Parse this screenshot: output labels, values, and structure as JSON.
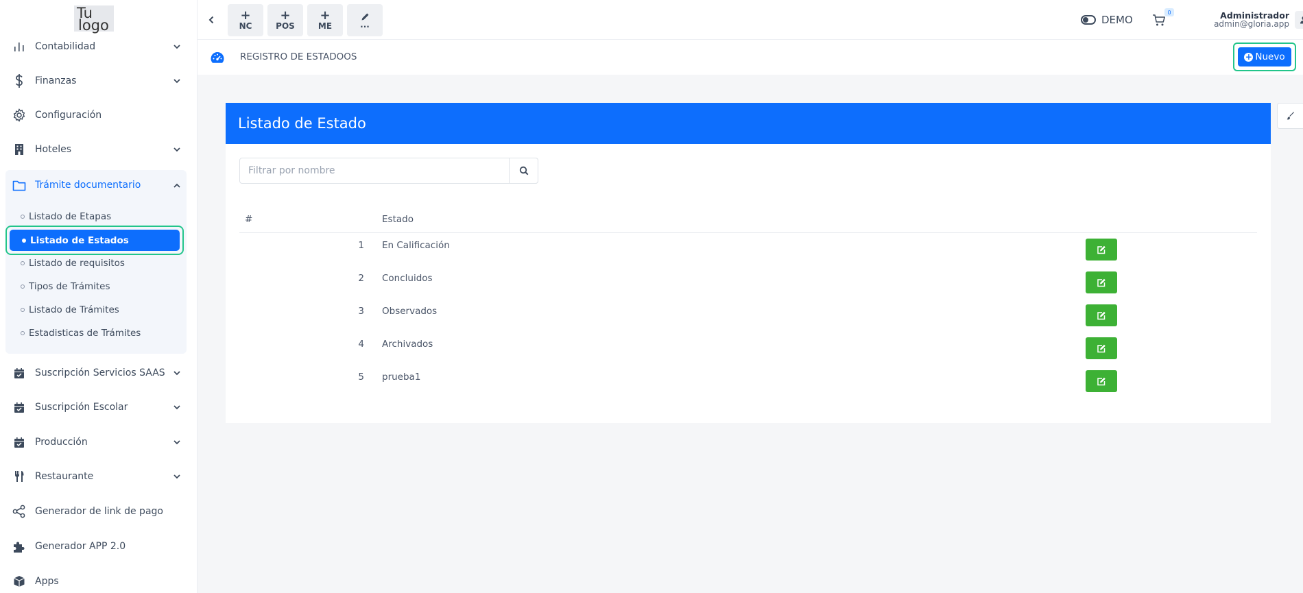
{
  "logo": {
    "line1": "Tu",
    "line2": "logo"
  },
  "sidebar": {
    "items": [
      {
        "label": "Contabilidad",
        "icon": "bar-chart-icon"
      },
      {
        "label": "Finanzas",
        "icon": "dollar-icon"
      },
      {
        "label": "Configuración",
        "icon": "gear-icon"
      },
      {
        "label": "Hoteles",
        "icon": "building-icon"
      },
      {
        "label": "Trámite documentario",
        "icon": "folder-icon"
      },
      {
        "label": "Suscripción Servicios SAAS",
        "icon": "calendar-check-icon"
      },
      {
        "label": "Suscripción Escolar",
        "icon": "calendar-check-icon"
      },
      {
        "label": "Producción",
        "icon": "calendar-check-icon"
      },
      {
        "label": "Restaurante",
        "icon": "utensils-icon"
      },
      {
        "label": "Generador de link de pago",
        "icon": "share-icon"
      },
      {
        "label": "Generador APP 2.0",
        "icon": "puzzle-icon"
      },
      {
        "label": "Apps",
        "icon": "box-icon"
      }
    ],
    "submenu": [
      "Listado de Etapas",
      "Listado de Estados",
      "Listado de requisitos",
      "Tipos de Trámites",
      "Listado de Trámites",
      "Estadisticas de Trámites"
    ]
  },
  "topbar": {
    "quick_buttons": [
      "NC",
      "POS",
      "ME",
      "..."
    ],
    "demo_label": "DEMO",
    "cart_count": "0",
    "user_name": "Administrador",
    "user_email": "admin@gloria.app"
  },
  "subheader": {
    "title": "REGISTRO DE ESTADOOS",
    "new_button": "Nuevo"
  },
  "card": {
    "title": "Listado de Estado",
    "filter_placeholder": "Filtrar por nombre",
    "columns": [
      "#",
      "Estado"
    ],
    "rows": [
      {
        "num": "1",
        "name": "En Calificación"
      },
      {
        "num": "2",
        "name": "Concluidos"
      },
      {
        "num": "3",
        "name": "Observados"
      },
      {
        "num": "4",
        "name": "Archivados"
      },
      {
        "num": "5",
        "name": "prueba1"
      }
    ]
  },
  "colors": {
    "primary": "#0d6efd",
    "success": "#3db135",
    "highlight": "#22c58b"
  }
}
